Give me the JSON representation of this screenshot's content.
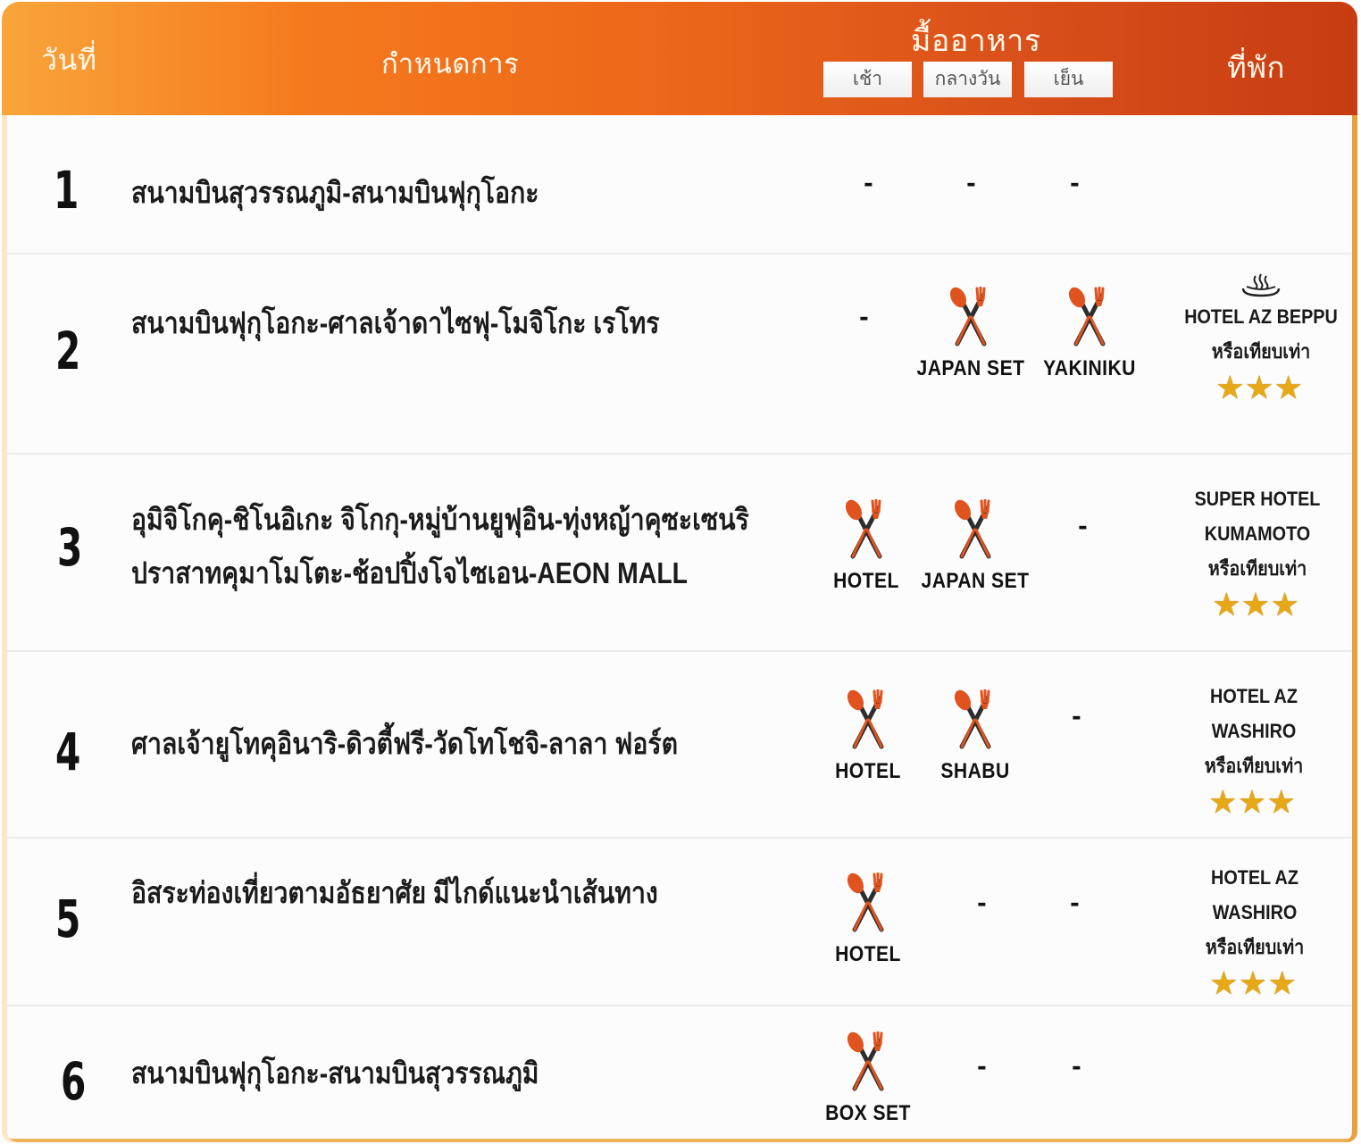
{
  "header": {
    "day": "วันที่",
    "program": "กำหนดการ",
    "meals": "มื้ออาหาร",
    "breakfast": "เช้า",
    "lunch": "กลางวัน",
    "dinner": "เย็น",
    "hotel": "ที่พัก"
  },
  "colors": {
    "header_gradient_start": "#f9a53a",
    "header_gradient_end": "#c73c12",
    "star": "#e6a817"
  },
  "days": [
    {
      "day": "1",
      "program": [
        "สนามบินสุวรรณภูมิ-สนามบินฟุกุโอกะ"
      ],
      "breakfast": {
        "text": "-"
      },
      "lunch": {
        "text": "-"
      },
      "dinner": {
        "text": "-"
      },
      "hotel": null
    },
    {
      "day": "2",
      "program": [
        "สนามบินฟุกุโอกะ-ศาลเจ้าดาไซฟุ-โมจิโกะ เรโทร"
      ],
      "breakfast": {
        "text": "-"
      },
      "lunch": {
        "icon": "fork-spoon-icon",
        "label": "JAPAN SET"
      },
      "dinner": {
        "icon": "fork-spoon-icon",
        "label": "YAKINIKU"
      },
      "hotel": {
        "icon": "onsen-icon",
        "lines": [
          "HOTEL AZ BEPPU",
          "หรือเทียบเท่า"
        ],
        "stars": "★★★"
      }
    },
    {
      "day": "3",
      "program": [
        "อุมิจิโกคุ-ชิโนอิเกะ จิโกกุ-หมู่บ้านยูฟุอิน-ทุ่งหญ้าคุซะเซนริ",
        "ปราสาทคุมาโมโตะ-ช้อปปิ้งโจไซเอน-AEON MALL"
      ],
      "breakfast": {
        "icon": "fork-spoon-icon",
        "label": "HOTEL"
      },
      "lunch": {
        "icon": "fork-spoon-icon",
        "label": "JAPAN SET"
      },
      "dinner": {
        "text": "-"
      },
      "hotel": {
        "lines": [
          "SUPER HOTEL",
          "KUMAMOTO",
          "หรือเทียบเท่า"
        ],
        "stars": "★★★"
      }
    },
    {
      "day": "4",
      "program": [
        "ศาลเจ้ายูโทคุอินาริ-ดิวตี้ฟรี-วัดโทโชจิ-ลาลา ฟอร์ต"
      ],
      "breakfast": {
        "icon": "fork-spoon-icon",
        "label": "HOTEL"
      },
      "lunch": {
        "icon": "fork-spoon-icon",
        "label": "SHABU"
      },
      "dinner": {
        "text": "-"
      },
      "hotel": {
        "lines": [
          "HOTEL AZ",
          "WASHIRO",
          "หรือเทียบเท่า"
        ],
        "stars": "★★★"
      }
    },
    {
      "day": "5",
      "program": [
        "อิสระท่องเที่ยวตามอัธยาศัย มีไกด์แนะนำเส้นทาง"
      ],
      "breakfast": {
        "icon": "fork-spoon-icon",
        "label": "HOTEL"
      },
      "lunch": {
        "text": "-"
      },
      "dinner": {
        "text": "-"
      },
      "hotel": {
        "lines": [
          "HOTEL AZ",
          "WASHIRO",
          "หรือเทียบเท่า"
        ],
        "stars": "★★★"
      }
    },
    {
      "day": "6",
      "program": [
        "สนามบินฟุกุโอกะ-สนามบินสุวรรณภูมิ"
      ],
      "breakfast": {
        "icon": "fork-spoon-icon",
        "label": "BOX SET"
      },
      "lunch": {
        "text": "-"
      },
      "dinner": {
        "text": "-"
      },
      "hotel": null
    }
  ]
}
